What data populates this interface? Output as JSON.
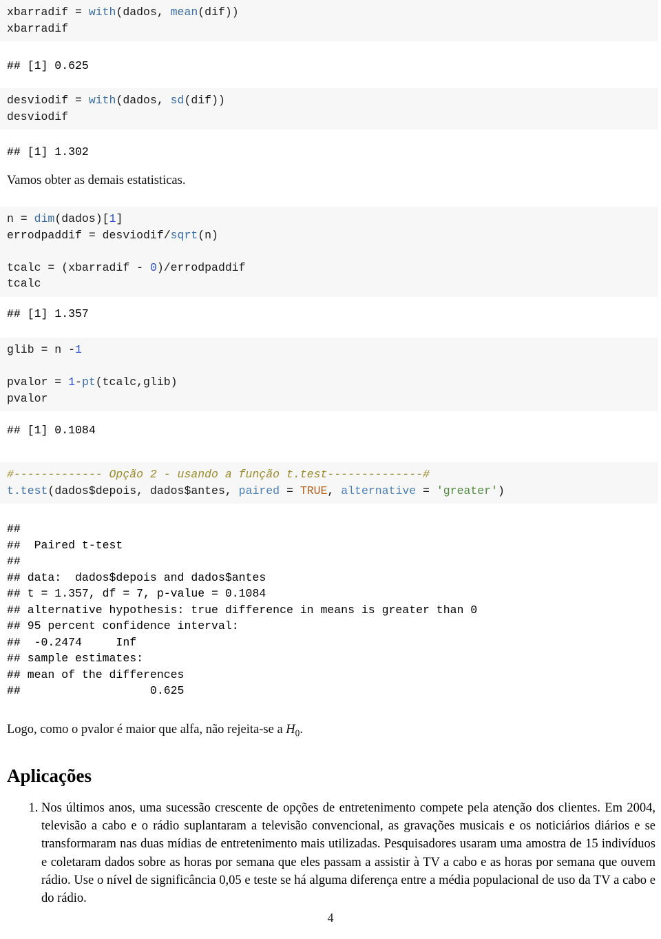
{
  "document": {
    "page_number": "4",
    "section_heading": "Aplicações"
  },
  "blocks": {
    "code1_line1_a": "xbarradif = ",
    "code1_line1_fn1": "with",
    "code1_line1_b": "(dados, ",
    "code1_line1_fn2": "mean",
    "code1_line1_c": "(dif))",
    "code1_line2": "xbarradif",
    "out1": "## [1] 0.625",
    "code2_line1_a": "desviodif = ",
    "code2_line1_fn1": "with",
    "code2_line1_b": "(dados, ",
    "code2_line1_fn2": "sd",
    "code2_line1_c": "(dif))",
    "code2_line2": "desviodif",
    "out2": "## [1] 1.302",
    "para1": "Vamos obter as demais estatisticas.",
    "code3_l1_a": "n = ",
    "code3_l1_fn": "dim",
    "code3_l1_b": "(dados)[",
    "code3_l1_num": "1",
    "code3_l1_c": "]",
    "code3_l2_a": "errodpaddif = desviodif/",
    "code3_l2_fn": "sqrt",
    "code3_l2_b": "(n)",
    "code3_l3": "",
    "code3_l4_a": "tcalc = (xbarradif - ",
    "code3_l4_num": "0",
    "code3_l4_b": ")/errodpaddif",
    "code3_l5": "tcalc",
    "out3": "## [1] 1.357",
    "code4_l1_a": "glib = n -",
    "code4_l1_num": "1",
    "code4_l2": "",
    "code4_l3_a": "pvalor = ",
    "code4_l3_num": "1",
    "code4_l3_b": "-",
    "code4_l3_fn": "pt",
    "code4_l3_c": "(tcalc,glib)",
    "code4_l4": "pvalor",
    "out4": "## [1] 0.1084",
    "code5_comment": "#------------- Opção 2 - usando a função t.test--------------#",
    "code5_l2_a": "t.test",
    "code5_l2_b": "(dados$depois, dados$antes, ",
    "code5_l2_arg1": "paired",
    "code5_l2_c": " = ",
    "code5_l2_const": "TRUE",
    "code5_l2_d": ", ",
    "code5_l2_arg2": "alternative",
    "code5_l2_e": " = ",
    "code5_l2_str": "'greater'",
    "code5_l2_f": ")",
    "out5": "## \n##  Paired t-test\n## \n## data:  dados$depois and dados$antes\n## t = 1.357, df = 7, p-value = 0.1084\n## alternative hypothesis: true difference in means is greater than 0\n## 95 percent confidence interval:\n##  -0.2474     Inf\n## sample estimates:\n## mean of the differences\n##                   0.625",
    "para2_before": "Logo, como o pvalor é maior que alfa, não rejeita-se a ",
    "para2_math_var": "H",
    "para2_math_sub": "0",
    "para2_after": ".",
    "list_item_1": "Nos últimos anos, uma sucessão crescente de opções de entretenimento compete pela atenção dos clientes. Em 2004, televisão a cabo e o rádio suplantaram a televisão convencional, as gravações musicais e os noticiários diários e se transformaram nas duas mídias de entretenimento mais utilizadas. Pesquisadores usaram uma amostra de 15 indivíduos e coletaram dados sobre as horas por semana que eles passam a assistir à TV a cabo e as horas por semana que ouvem rádio. Use o nível de significância 0,05 e teste se há alguma diferença entre a média populacional de uso da TV a cabo e do rádio."
  },
  "colors": {
    "code_background": "#f7f7f7",
    "function": "#3a6ea5",
    "number": "#2b4fd0",
    "argument": "#4a7ebb",
    "constant": "#b8601d",
    "string": "#4f8a3d",
    "comment": "#9a8b2e"
  }
}
